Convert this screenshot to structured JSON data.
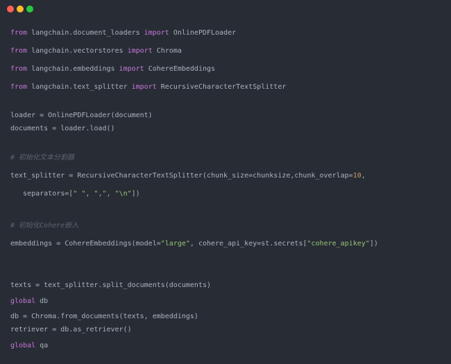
{
  "window": {
    "controls": [
      {
        "name": "close",
        "color": "#ff5f56"
      },
      {
        "name": "minimize",
        "color": "#ffbd2e"
      },
      {
        "name": "maximize",
        "color": "#27c93f"
      }
    ]
  },
  "colors": {
    "background": "#282c34",
    "keyword": "#c678dd",
    "string": "#98c379",
    "number": "#d19a66",
    "text": "#abb2bf",
    "comment": "#5c6370"
  },
  "code": {
    "lines": [
      [
        {
          "t": "from",
          "c": "kw"
        },
        {
          "t": " langchain.document_loaders ",
          "c": "tx"
        },
        {
          "t": "import",
          "c": "kw"
        },
        {
          "t": " OnlinePDFLoader",
          "c": "tx"
        }
      ],
      [
        {
          "t": "from",
          "c": "kw"
        },
        {
          "t": " langchain.vectorstores ",
          "c": "tx"
        },
        {
          "t": "import",
          "c": "kw"
        },
        {
          "t": " Chroma",
          "c": "tx"
        }
      ],
      [
        {
          "t": "from",
          "c": "kw"
        },
        {
          "t": " langchain.embeddings ",
          "c": "tx"
        },
        {
          "t": "import",
          "c": "kw"
        },
        {
          "t": " CohereEmbeddings",
          "c": "tx"
        }
      ],
      [
        {
          "t": "from",
          "c": "kw"
        },
        {
          "t": " langchain.text_splitter ",
          "c": "tx"
        },
        {
          "t": "import",
          "c": "kw"
        },
        {
          "t": " RecursiveCharacterTextSplitter",
          "c": "tx"
        }
      ],
      [
        {
          "t": "loader = OnlinePDFLoader(document)",
          "c": "tx"
        }
      ],
      [
        {
          "t": "documents = loader.load()",
          "c": "tx"
        }
      ],
      [
        {
          "t": "# 初始化文本分割器",
          "c": "cm"
        }
      ],
      [
        {
          "t": "text_splitter = RecursiveCharacterTextSplitter(chunk_size=chunksize,chunk_overlap=",
          "c": "tx"
        },
        {
          "t": "10",
          "c": "num"
        },
        {
          "t": ",",
          "c": "tx"
        }
      ],
      [
        {
          "t": "   separators=[",
          "c": "tx"
        },
        {
          "t": "\" \"",
          "c": "str"
        },
        {
          "t": ", ",
          "c": "tx"
        },
        {
          "t": "\",\"",
          "c": "str"
        },
        {
          "t": ", ",
          "c": "tx"
        },
        {
          "t": "\"\\n\"",
          "c": "str"
        },
        {
          "t": "])",
          "c": "tx"
        }
      ],
      [
        {
          "t": "# 初始化Cohere嵌入",
          "c": "cm"
        }
      ],
      [
        {
          "t": "embeddings = CohereEmbeddings(model=",
          "c": "tx"
        },
        {
          "t": "\"large\"",
          "c": "str"
        },
        {
          "t": ", cohere_api_key=st.secrets[",
          "c": "tx"
        },
        {
          "t": "\"cohere_apikey\"",
          "c": "str"
        },
        {
          "t": "])",
          "c": "tx"
        }
      ],
      [
        {
          "t": "texts = text_splitter.split_documents(documents)",
          "c": "tx"
        }
      ],
      [
        {
          "t": "global",
          "c": "kw"
        },
        {
          "t": " db",
          "c": "tx"
        }
      ],
      [
        {
          "t": "db = Chroma.from_documents(texts, embeddings)",
          "c": "tx"
        }
      ],
      [
        {
          "t": "retriever = db.as_retriever()",
          "c": "tx"
        }
      ],
      [
        {
          "t": "global",
          "c": "kw"
        },
        {
          "t": " qa",
          "c": "tx"
        }
      ]
    ]
  }
}
